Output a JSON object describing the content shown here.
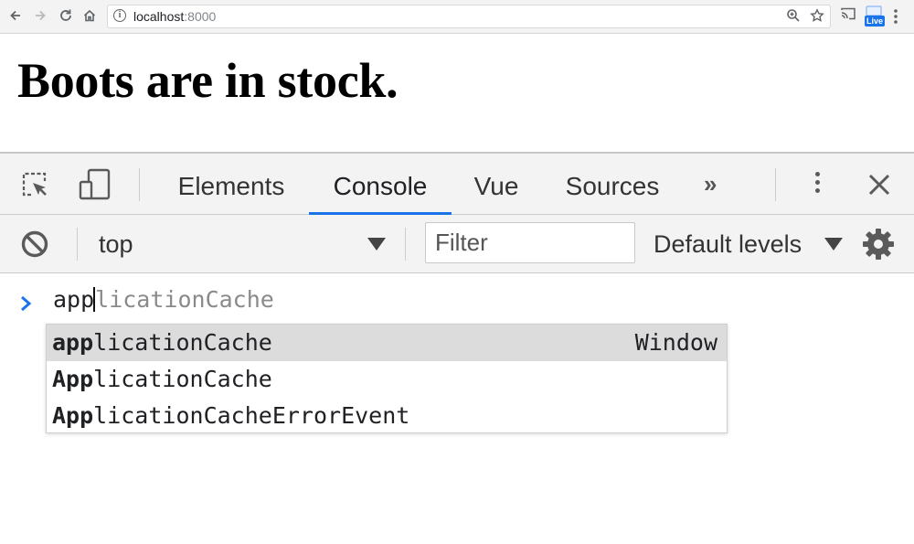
{
  "browser": {
    "url_host": "localhost",
    "url_port": ":8000",
    "live_badge": "Live"
  },
  "page": {
    "heading": "Boots are in stock."
  },
  "devtools": {
    "tabs": [
      {
        "label": "Elements",
        "active": false
      },
      {
        "label": "Console",
        "active": true
      },
      {
        "label": "Vue",
        "active": false
      },
      {
        "label": "Sources",
        "active": false
      }
    ],
    "overflow_label": "»",
    "console_toolbar": {
      "context": "top",
      "filter_placeholder": "Filter",
      "levels": "Default levels"
    },
    "console": {
      "typed": "app",
      "completion_hint": "licationCache",
      "suggestions": [
        {
          "match": "app",
          "rest": "licationCache",
          "type": "Window",
          "selected": true
        },
        {
          "match": "App",
          "rest": "licationCache",
          "type": "",
          "selected": false
        },
        {
          "match": "App",
          "rest": "licationCacheErrorEvent",
          "type": "",
          "selected": false
        }
      ]
    }
  },
  "colors": {
    "accent": "#1a73e8",
    "toolbar_bg": "#f3f3f3",
    "selected_row": "#dcdcdc"
  }
}
